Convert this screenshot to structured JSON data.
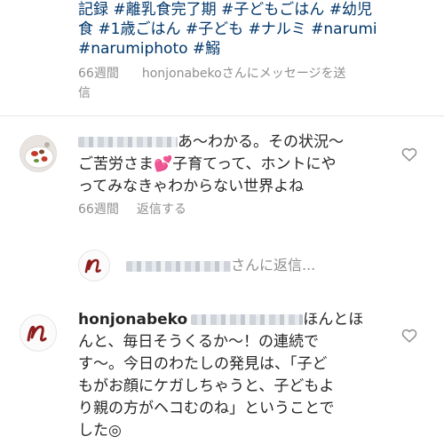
{
  "caption": {
    "hashtag_lines": [
      "記録 #離乳食完了期 #子どもごはん #幼児",
      "食 #1歳ごはん #子ども #ナルミ #narumi",
      "#narumiphoto #鰯"
    ]
  },
  "caption_meta": {
    "time": "66週間",
    "message_link_line1": "honjonabekoさんにメッセージを送",
    "message_link_line2": "信"
  },
  "comment1": {
    "text_line1": "あ〜わかる。その状況〜",
    "text_line2a": "ご苦労さま",
    "heart_emoji": "💕",
    "text_line2b": "子育てって、ホントにや",
    "text_line3": "ってみなきゃわからない世界よね",
    "time": "66週間",
    "reply_label": "返信する"
  },
  "reply_box": {
    "suffix": "さんに返信..."
  },
  "comment2": {
    "username": "honjonabeko",
    "text_line1b": "ほんとほ",
    "text_line2": "んと、毎日そうくるか〜！の連続で",
    "text_line3": "す〜。今日のわたしの発見は、「子ど",
    "text_line4": "もがお顔にケガしちゃうと、子どもよ",
    "text_line5": "り親の方がヘコむのね」ということで",
    "text_line6": "した◎"
  },
  "colors": {
    "hashtag": "#00376b",
    "secondary_text": "#8e8e8e",
    "primary_text": "#262626",
    "heart_emoji": "#d9294b",
    "logo_red": "#8e1d1d"
  },
  "icons": {
    "like": "heart-outline-icon",
    "avatar_logo": "n-logo"
  }
}
